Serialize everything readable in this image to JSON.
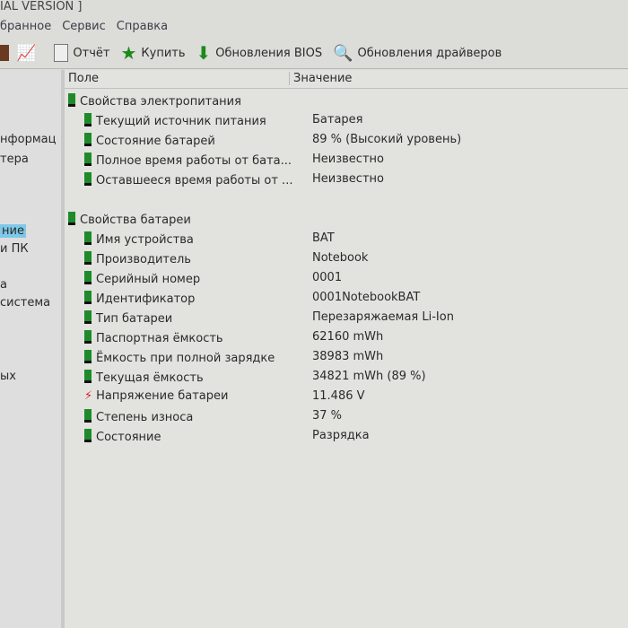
{
  "title": "IAL VERSION ]",
  "menu": [
    "бранное",
    "Сервис",
    "Справка"
  ],
  "toolbar": {
    "report": "Отчёт",
    "buy": "Купить",
    "bios": "Обновления BIOS",
    "drivers": "Обновления драйверов"
  },
  "sidebar": [
    "нформац",
    "тера",
    "ние",
    "и ПК",
    "а",
    "система",
    "ых"
  ],
  "columns": {
    "field": "Поле",
    "value": "Значение"
  },
  "groups": [
    {
      "title": "Свойства электропитания",
      "rows": [
        [
          "Текущий источник питания",
          "Батарея"
        ],
        [
          "Состояние батарей",
          "89 % (Высокий уровень)"
        ],
        [
          "Полное время работы от бата...",
          "Неизвестно"
        ],
        [
          "Оставшееся время работы от ...",
          "Неизвестно"
        ]
      ]
    },
    {
      "title": "Свойства батареи",
      "rows": [
        [
          "Имя устройства",
          "BAT"
        ],
        [
          "Производитель",
          "Notebook"
        ],
        [
          "Серийный номер",
          "0001"
        ],
        [
          "Идентификатор",
          "0001NotebookBAT"
        ],
        [
          "Тип батареи",
          "Перезаряжаемая Li-Ion"
        ],
        [
          "Паспортная ёмкость",
          "62160 mWh"
        ],
        [
          "Ёмкость при полной зарядке",
          "38983 mWh"
        ],
        [
          "Текущая ёмкость",
          "34821 mWh  (89 %)"
        ],
        [
          "Напряжение батареи",
          "11.486 V"
        ],
        [
          "Степень износа",
          "37 %"
        ],
        [
          "Состояние",
          "Разрядка"
        ]
      ]
    }
  ]
}
